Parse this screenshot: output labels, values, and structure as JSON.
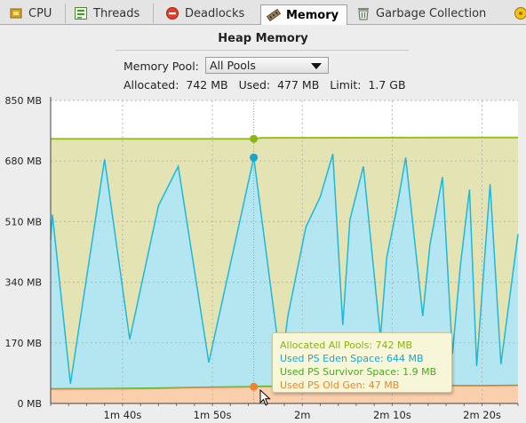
{
  "tabs": [
    {
      "label": "CPU",
      "icon": "cpu-icon"
    },
    {
      "label": "Threads",
      "icon": "threads-icon"
    },
    {
      "label": "Deadlocks",
      "icon": "deadlocks-icon"
    },
    {
      "label": "Memory",
      "icon": "memory-icon",
      "active": true
    },
    {
      "label": "Garbage Collection",
      "icon": "garbage-collection-icon"
    }
  ],
  "panel": {
    "title": "Heap Memory",
    "pool_label": "Memory Pool:",
    "pool_value": "All Pools",
    "allocated_label": "Allocated:",
    "allocated_value": "742 MB",
    "used_label": "Used:",
    "used_value": "477 MB",
    "limit_label": "Limit:",
    "limit_value": "1.7 GB"
  },
  "tooltip": {
    "allocated": "Allocated All Pools: 742 MB",
    "eden": "Used PS Eden Space: 644 MB",
    "survivor": "Used PS Survivor Space: 1.9 MB",
    "old": "Used PS Old Gen: 47 MB"
  },
  "colors": {
    "allocated_fill": "#e3e3b4",
    "allocated_line": "#9bbf1e",
    "eden_fill": "#b4e6f2",
    "eden_line": "#1fb8d8",
    "survivor_line": "#58b82a",
    "old_fill": "#f9cfae",
    "old_line": "#f0924e",
    "tooltip_allocated": "#8fb018",
    "tooltip_eden": "#18a6cf",
    "tooltip_survivor": "#45ad1c",
    "tooltip_old": "#e8872c"
  },
  "chart_data": {
    "type": "area",
    "y_unit": "MB",
    "ylim": [
      0,
      850
    ],
    "y_ticks": [
      "0 MB",
      "170 MB",
      "340 MB",
      "510 MB",
      "680 MB",
      "850 MB"
    ],
    "y_tick_values": [
      0,
      170,
      340,
      510,
      680,
      850
    ],
    "x_ticks": [
      "1m 40s",
      "1m 50s",
      "2m",
      "2m 10s",
      "2m 20s"
    ],
    "x_tick_seconds": [
      100,
      110,
      120,
      130,
      140
    ],
    "xlim_seconds": [
      92,
      144
    ],
    "grid": true,
    "legend": "tooltip",
    "series": [
      {
        "name": "Allocated All Pools",
        "x": [
          92,
          114.5,
          115.5,
          144
        ],
        "values": [
          742,
          742,
          745,
          746
        ]
      },
      {
        "name": "Used PS Eden Space",
        "x": [
          92,
          92.2,
          94.2,
          98,
          100.8,
          104,
          106.2,
          109.6,
          114.6,
          117.4,
          117.8,
          118.4,
          120.4,
          122,
          123.4,
          124.5,
          125.3,
          126.8,
          128.7,
          129.4,
          130.5,
          131.5,
          133.4,
          134.2,
          135.6,
          136.7,
          137.6,
          138.6,
          139.4,
          140.9,
          142.1,
          144
        ],
        "values": [
          460,
          530,
          55,
          685,
          180,
          555,
          665,
          115,
          690,
          150,
          130,
          245,
          495,
          580,
          700,
          220,
          515,
          665,
          185,
          410,
          545,
          690,
          245,
          445,
          635,
          140,
          390,
          600,
          105,
          615,
          110,
          475
        ]
      },
      {
        "name": "Used PS Survivor Space",
        "x": [
          92,
          144
        ],
        "values": [
          1.9,
          1.9
        ]
      },
      {
        "name": "Used PS Old Gen",
        "x": [
          92,
          100,
          104,
          108,
          114.5,
          115.5,
          120,
          128,
          136,
          140,
          144
        ],
        "values": [
          40,
          41,
          42,
          44,
          46,
          47,
          47,
          48,
          49,
          49,
          50
        ]
      }
    ],
    "hover": {
      "x": 114.6,
      "values": {
        "allocated": 742,
        "eden": 690,
        "old": 47
      }
    }
  }
}
